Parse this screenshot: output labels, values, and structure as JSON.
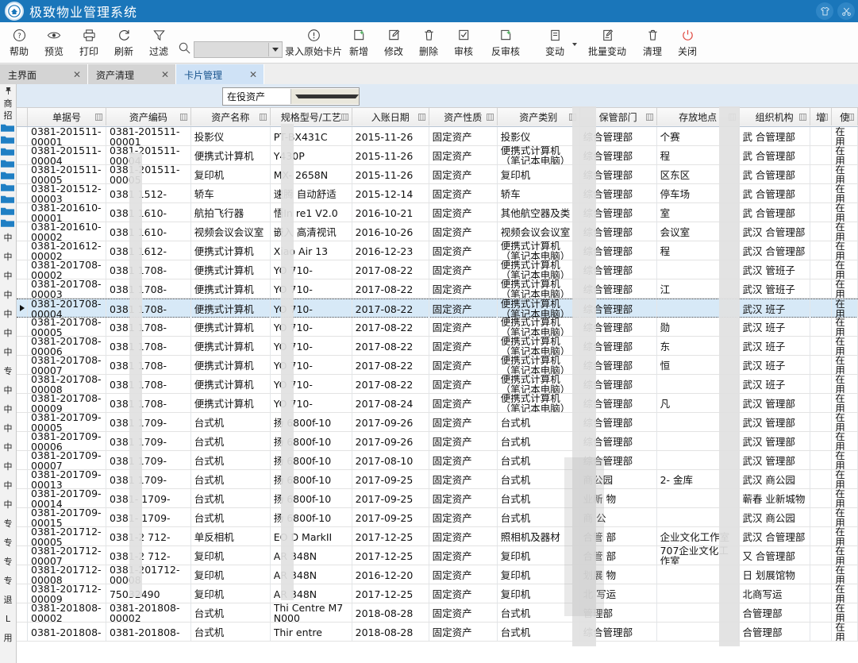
{
  "window": {
    "title": "极致物业管理系统",
    "logo_icon": "circle-logo-icon",
    "right_icons": [
      "shirt-icon",
      "scissors-icon"
    ]
  },
  "toolbar": {
    "buttons": [
      {
        "label": "帮助",
        "icon": "question-circle-icon"
      },
      {
        "label": "预览",
        "icon": "eye-icon"
      },
      {
        "label": "打印",
        "icon": "printer-icon"
      },
      {
        "label": "刷新",
        "icon": "refresh-icon"
      },
      {
        "label": "过滤",
        "icon": "funnel-icon"
      }
    ],
    "search": {
      "icon": "search-icon",
      "value": "",
      "placeholder": ""
    },
    "buttons2": [
      {
        "label": "录入原始卡片",
        "icon": "exclamation-circle-icon"
      },
      {
        "label": "新增",
        "icon": "add-square-icon"
      },
      {
        "label": "修改",
        "icon": "edit-square-icon"
      },
      {
        "label": "删除",
        "icon": "trash-icon"
      },
      {
        "label": "审核",
        "icon": "check-square-icon"
      },
      {
        "label": "反审核",
        "icon": "add-square-icon"
      },
      {
        "label": "变动",
        "icon": "document-icon"
      },
      {
        "label": "批量变动",
        "icon": "document-edit-icon"
      },
      {
        "label": "清理",
        "icon": "trash-icon"
      },
      {
        "label": "关闭",
        "icon": "power-icon"
      }
    ]
  },
  "tabs": [
    {
      "label": "主界面",
      "close": "✕",
      "active": false
    },
    {
      "label": "资产清理",
      "close": "✕",
      "active": false
    },
    {
      "label": "卡片管理",
      "close": "✕",
      "active": true
    }
  ],
  "left_panel": {
    "pin_icon": "pin-icon",
    "labels": [
      "商",
      "招"
    ],
    "tail_labels": [
      "中",
      "中",
      "中",
      "中",
      "中",
      "中",
      "中",
      "专",
      "中",
      "中",
      "中",
      "中",
      "中",
      "中",
      "中",
      "专",
      "专",
      "专",
      "专",
      "退",
      "L",
      "用"
    ]
  },
  "filter": {
    "status_select": {
      "value": "在役资产",
      "dropdown_icon": "chevron-down-icon"
    }
  },
  "grid": {
    "columns": [
      {
        "label": "单据号",
        "sort_icon": "sort-icon",
        "w": "w1"
      },
      {
        "label": "资产编码",
        "sort_icon": "sort-icon",
        "w": "w2"
      },
      {
        "label": "资产名称",
        "sort_icon": "sort-icon",
        "w": "w3"
      },
      {
        "label": "规格型号/工艺",
        "sort_icon": "sort-icon",
        "w": "w4"
      },
      {
        "label": "入账日期",
        "sort_icon": "sort-icon",
        "w": "w5"
      },
      {
        "label": "资产性质",
        "sort_icon": "sort-icon",
        "w": "w6"
      },
      {
        "label": "资产类别",
        "sort_icon": "sort-icon",
        "w": "w7"
      },
      {
        "label": "保管部门",
        "sort_icon": "sort-icon",
        "w": "w8"
      },
      {
        "label": "存放地点",
        "sort_icon": "sort-icon",
        "w": "w9"
      },
      {
        "label": "组织机构",
        "sort_icon": "sort-icon",
        "w": "w10"
      },
      {
        "label": "增",
        "sort_icon": "sort-icon",
        "w": "w11"
      },
      {
        "label": "使",
        "sort_icon": "sort-icon",
        "w": "w12"
      }
    ],
    "selected_row_index": 9,
    "row_marker_icon": "row-pointer-icon",
    "rows": [
      {
        "doc": "0381-201511-00001",
        "code": "0381-201511-00001",
        "name": "投影仪",
        "model": "PT-BX431C",
        "date": "2015-11-26",
        "nature": "固定资产",
        "category": "投影仪",
        "dept": "综合管理部",
        "place": "个赛",
        "org": "武  合管理部",
        "inc": "",
        "use": "在用"
      },
      {
        "doc": "0381-201511-00004",
        "code": "0381-201511-00004",
        "name": "便携式计算机",
        "model": "Y430P",
        "date": "2015-11-26",
        "nature": "固定资产",
        "category": "便携式计算机（笔记本电脑）",
        "dept": "综合管理部",
        "place": "程",
        "org": "武  合管理部",
        "inc": "",
        "use": "在用"
      },
      {
        "doc": "0381-201511-00005",
        "code": "0381-201511-00005",
        "name": "复印机",
        "model": "MX-  2658N",
        "date": "2015-11-26",
        "nature": "固定资产",
        "category": "复印机",
        "dept": "综合管理部",
        "place": "区东区",
        "org": "武  合管理部",
        "inc": "",
        "use": "在用"
      },
      {
        "doc": "0381-201512-00003",
        "code": "0381   1512-",
        "name": "轿车",
        "model": "速腾  自动舒适",
        "date": "2015-12-14",
        "nature": "固定资产",
        "category": "轿车",
        "dept": "综合管理部",
        "place": "停车场",
        "org": "武  合管理部",
        "inc": "",
        "use": "在用"
      },
      {
        "doc": "0381-201610-00001",
        "code": "0381   1610-",
        "name": "航拍飞行器",
        "model": "悟In   re1 V2.0",
        "date": "2016-10-21",
        "nature": "固定资产",
        "category": "其他航空器及类",
        "dept": "综合管理部",
        "place": "室",
        "org": "武  合管理部",
        "inc": "",
        "use": "在用"
      },
      {
        "doc": "0381-201610-00002",
        "code": "0381   1610-",
        "name": "视频会议会议室",
        "model": "嵌入  高清视讯",
        "date": "2016-10-26",
        "nature": "固定资产",
        "category": "视频会议会议室",
        "dept": "综合管理部",
        "place": "会议室",
        "org": "武汉  合管理部",
        "inc": "",
        "use": "在用"
      },
      {
        "doc": "0381-201612-00002",
        "code": "0381   1612-",
        "name": "便携式计算机",
        "model": "Xiao   Air 13",
        "date": "2016-12-23",
        "nature": "固定资产",
        "category": "便携式计算机（笔记本电脑）",
        "dept": "综合管理部",
        "place": "程",
        "org": "武汉  合管理部",
        "inc": "",
        "use": "在用"
      },
      {
        "doc": "0381-201708-00002",
        "code": "0381   1708-",
        "name": "便携式计算机",
        "model": "YO   710-",
        "date": "2017-08-22",
        "nature": "固定资产",
        "category": "便携式计算机（笔记本电脑）",
        "dept": "综合管理部",
        "place": "",
        "org": "武汉  管班子",
        "inc": "",
        "use": "在用"
      },
      {
        "doc": "0381-201708-00003",
        "code": "0381   1708-",
        "name": "便携式计算机",
        "model": "YO   710-",
        "date": "2017-08-22",
        "nature": "固定资产",
        "category": "便携式计算机（笔记本电脑）",
        "dept": "综合管理部",
        "place": "江",
        "org": "武汉  管班子",
        "inc": "",
        "use": "在用"
      },
      {
        "doc": "0381-201708-00004",
        "code": "0381   1708-",
        "name": "便携式计算机",
        "model": "YO   710-",
        "date": "2017-08-22",
        "nature": "固定资产",
        "category": "便携式计算机（笔记本电脑）",
        "dept": "综合管理部",
        "place": "",
        "org": "武汉  班子",
        "inc": "",
        "use": "在用"
      },
      {
        "doc": "0381-201708-00005",
        "code": "0381   1708-",
        "name": "便携式计算机",
        "model": "YO   710-",
        "date": "2017-08-22",
        "nature": "固定资产",
        "category": "便携式计算机（笔记本电脑）",
        "dept": "综合管理部",
        "place": "勋",
        "org": "武汉  班子",
        "inc": "",
        "use": "在用"
      },
      {
        "doc": "0381-201708-00006",
        "code": "0381   1708-",
        "name": "便携式计算机",
        "model": "YO   710-",
        "date": "2017-08-22",
        "nature": "固定资产",
        "category": "便携式计算机（笔记本电脑）",
        "dept": "综合管理部",
        "place": "东",
        "org": "武汉  班子",
        "inc": "",
        "use": "在用"
      },
      {
        "doc": "0381-201708-00007",
        "code": "0381   1708-",
        "name": "便携式计算机",
        "model": "YO   710-",
        "date": "2017-08-22",
        "nature": "固定资产",
        "category": "便携式计算机（笔记本电脑）",
        "dept": "综合管理部",
        "place": "恒",
        "org": "武汉  班子",
        "inc": "",
        "use": "在用"
      },
      {
        "doc": "0381-201708-00008",
        "code": "0381   1708-",
        "name": "便携式计算机",
        "model": "YO   710-",
        "date": "2017-08-22",
        "nature": "固定资产",
        "category": "便携式计算机（笔记本电脑）",
        "dept": "综合管理部",
        "place": "",
        "org": "武汉  班子",
        "inc": "",
        "use": "在用"
      },
      {
        "doc": "0381-201708-00009",
        "code": "0381   1708-",
        "name": "便携式计算机",
        "model": "YO   710-",
        "date": "2017-08-24",
        "nature": "固定资产",
        "category": "便携式计算机（笔记本电脑）",
        "dept": "综合管理部",
        "place": "凡",
        "org": "武汉  管理部",
        "inc": "",
        "use": "在用"
      },
      {
        "doc": "0381-201709-00005",
        "code": "0381   1709-",
        "name": "台式机",
        "model": "扬  6800f-10",
        "date": "2017-09-26",
        "nature": "固定资产",
        "category": "台式机",
        "dept": "综合管理部",
        "place": "",
        "org": "武汉  管理部",
        "inc": "",
        "use": "在用"
      },
      {
        "doc": "0381-201709-00006",
        "code": "0381   1709-",
        "name": "台式机",
        "model": "扬  6800f-10",
        "date": "2017-09-26",
        "nature": "固定资产",
        "category": "台式机",
        "dept": "综合管理部",
        "place": "",
        "org": "武汉  管理部",
        "inc": "",
        "use": "在用"
      },
      {
        "doc": "0381-201709-00007",
        "code": "0381   1709-",
        "name": "台式机",
        "model": "扬  6800f-10",
        "date": "2017-08-10",
        "nature": "固定资产",
        "category": "台式机",
        "dept": "综合管理部",
        "place": "",
        "org": "武汉  管理部",
        "inc": "",
        "use": "在用"
      },
      {
        "doc": "0381-201709-00013",
        "code": "0381   1709-",
        "name": "台式机",
        "model": "扬  6800f-10",
        "date": "2017-09-25",
        "nature": "固定资产",
        "category": "台式机",
        "dept": "商公园",
        "place": "2-  金库",
        "org": "武汉  商公园",
        "inc": "",
        "use": "在用"
      },
      {
        "doc": "0381-201709-00014",
        "code": "0381-  1709-",
        "name": "台式机",
        "model": "扬  6800f-10",
        "date": "2017-09-25",
        "nature": "固定资产",
        "category": "台式机",
        "dept": "业新  物",
        "place": "",
        "org": "蕲春  业新城物",
        "inc": "",
        "use": "在用"
      },
      {
        "doc": "0381-201709-00015",
        "code": "0381-  1709-",
        "name": "台式机",
        "model": "扬  6800f-10",
        "date": "2017-09-25",
        "nature": "固定资产",
        "category": "台式机",
        "dept": "商  公",
        "place": "",
        "org": "武汉  商公园",
        "inc": "",
        "use": "在用"
      },
      {
        "doc": "0381-201712-00005",
        "code": "0381-2  712-",
        "name": "单反相机",
        "model": "EO   D MarkII",
        "date": "2017-12-25",
        "nature": "固定资产",
        "category": "照相机及器材",
        "dept": "合管  部",
        "place": "企业文化工作室",
        "org": "武汉  合管理部",
        "inc": "",
        "use": "在用"
      },
      {
        "doc": "0381-201712-00007",
        "code": "0381-2  712-",
        "name": "复印机",
        "model": "AR   348N",
        "date": "2017-12-25",
        "nature": "固定资产",
        "category": "复印机",
        "dept": "合管  部",
        "place": "707企业文化工作室",
        "org": "又  合管理部",
        "inc": "",
        "use": "在用"
      },
      {
        "doc": "0381-201712-00008",
        "code": "0381-201712-00008",
        "name": "复印机",
        "model": "AR   348N",
        "date": "2016-12-20",
        "nature": "固定资产",
        "category": "复印机",
        "dept": "划展  物",
        "place": "",
        "org": "日  划展馆物",
        "inc": "",
        "use": "在用"
      },
      {
        "doc": "0381-201712-00009",
        "code": "75032490",
        "name": "复印机",
        "model": "AR   348N",
        "date": "2017-12-25",
        "nature": "固定资产",
        "category": "复印机",
        "dept": "北  写运",
        "place": "",
        "org": "北商写运",
        "inc": "",
        "use": "在用"
      },
      {
        "doc": "0381-201808-00002",
        "code": "0381-201808-00002",
        "name": "台式机",
        "model": "Thi   Centre M7    N000",
        "date": "2018-08-28",
        "nature": "固定资产",
        "category": "台式机",
        "dept": "管理部",
        "place": "",
        "org": "合管理部",
        "inc": "",
        "use": "在用"
      },
      {
        "doc": "0381-201808-",
        "code": "0381-201808-",
        "name": "台式机",
        "model": "Thir    entre",
        "date": "2018-08-28",
        "nature": "固定资产",
        "category": "台式机",
        "dept": "综合管理部",
        "place": "",
        "org": "合管理部",
        "inc": "",
        "use": "在用"
      }
    ]
  }
}
